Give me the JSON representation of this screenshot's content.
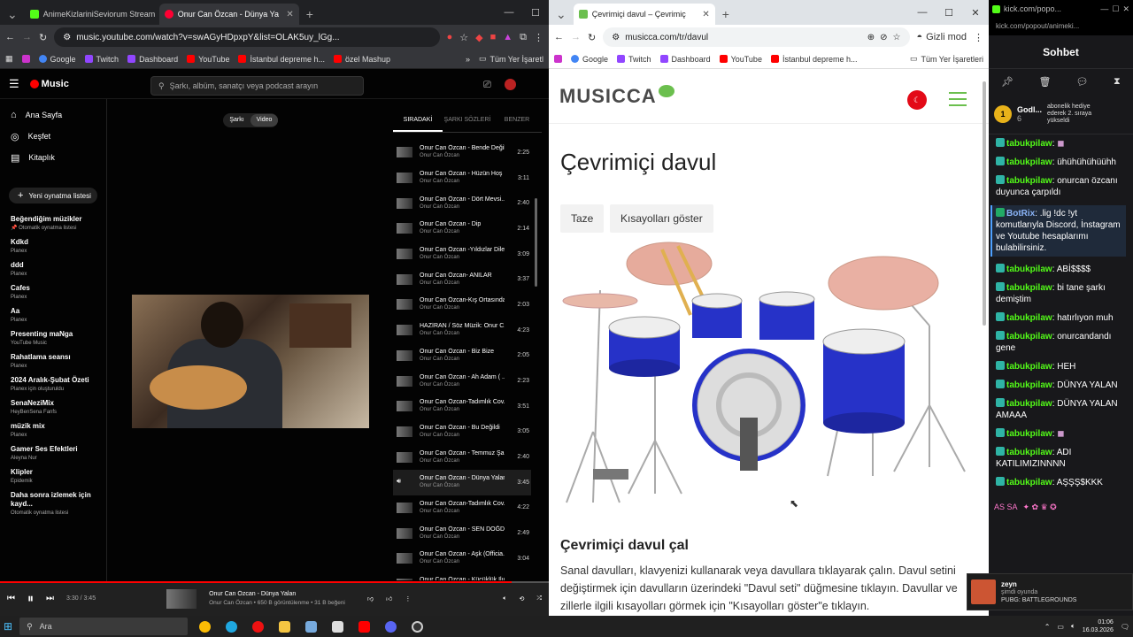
{
  "win1": {
    "tabs": [
      {
        "label": "AnimeKizlariniSeviorum Stream",
        "color": "#53fc18"
      },
      {
        "label": "Onur Can Özcan - Dünya Ya",
        "color": "#f03"
      }
    ],
    "url": "music.youtube.com/watch?v=swAGyHDpxpY&list=OLAK5uy_lGg...",
    "bookmarks": [
      "Google",
      "Twitch",
      "Dashboard",
      "YouTube",
      "İstanbul depreme h...",
      "özel Mashup"
    ],
    "bookmarks_folder": "Tüm Yer İşaretl",
    "app": {
      "logo": "Music",
      "search_placeholder": "Şarkı, albüm, sanatçı veya podcast arayın",
      "nav": [
        {
          "label": "Ana Sayfa",
          "icon": "home-icon",
          "glyph": "⌂"
        },
        {
          "label": "Keşfet",
          "icon": "compass-icon",
          "glyph": "◎"
        },
        {
          "label": "Kitaplık",
          "icon": "library-icon",
          "glyph": "▤"
        }
      ],
      "new_playlist": "Yeni oynatma listesi",
      "playlists": [
        {
          "title": "Beğendiğim müzikler",
          "sub": "📌 Otomatik oynatma listesi"
        },
        {
          "title": "Kdkd",
          "sub": "Planex"
        },
        {
          "title": "ddd",
          "sub": "Planex"
        },
        {
          "title": "Cafes",
          "sub": "Planex"
        },
        {
          "title": "Aa",
          "sub": "Planex"
        },
        {
          "title": "Presenting maNga",
          "sub": "YouTube Music"
        },
        {
          "title": "Rahatlama seansı",
          "sub": "Planex"
        },
        {
          "title": "2024 Aralık-Şubat Özeti",
          "sub": "Planex için oluşturuldu"
        },
        {
          "title": "SenaNeziMix",
          "sub": "HeyBenSena Fanfs"
        },
        {
          "title": "müzik mix",
          "sub": "Planex"
        },
        {
          "title": "Gamer Ses Efektleri",
          "sub": "Aleyna Nur"
        },
        {
          "title": "Klipler",
          "sub": "Epidemik"
        },
        {
          "title": "Daha sonra izlemek için kayd...",
          "sub": "Otomatik oynatma listesi"
        }
      ],
      "toggle": [
        "Şarkı",
        "Video"
      ],
      "queue_tabs": [
        "SIRADAKİ",
        "ŞARKI SÖZLERİ",
        "BENZER"
      ],
      "queue": [
        {
          "title": "Onur Can Özcan - Bende Değil...",
          "artist": "Onur Can Özcan",
          "dur": "2:25"
        },
        {
          "title": "Onur Can Özcan - Hüzün Hoş ...",
          "artist": "Onur Can Özcan",
          "dur": "3:11"
        },
        {
          "title": "Onur Can Özcan - Dört Mevsi...",
          "artist": "Onur Can Özcan",
          "dur": "2:40"
        },
        {
          "title": "Onur Can Özcan - Dip",
          "artist": "Onur Can Özcan",
          "dur": "2:14"
        },
        {
          "title": "Onur Can Özcan -Yıldızlar Dile...",
          "artist": "Onur Can Özcan",
          "dur": "3:09"
        },
        {
          "title": "Onur Can Özcan- ANILAR",
          "artist": "Onur Can Özcan",
          "dur": "3:37"
        },
        {
          "title": "Onur Can Özcan-Kış Ortasında",
          "artist": "Onur Can Özcan",
          "dur": "2:03"
        },
        {
          "title": "HAZİRAN / Söz Müzik: Onur C...",
          "artist": "Onur Can Özcan",
          "dur": "4:23"
        },
        {
          "title": "Onur Can Özcan - Biz Bize",
          "artist": "Onur Can Özcan",
          "dur": "2:05"
        },
        {
          "title": "Onur Can Özcan - Ah Adam ( ...",
          "artist": "Onur Can Özcan",
          "dur": "2:23"
        },
        {
          "title": "Onur Can Özcan-Tadımlık Cov...",
          "artist": "Onur Can Özcan",
          "dur": "3:51"
        },
        {
          "title": "Onur Can Özcan - Bu Değildi",
          "artist": "Onur Can Özcan",
          "dur": "3:05"
        },
        {
          "title": "Onur Can Özcan - Temmuz Şa...",
          "artist": "Onur Can Özcan",
          "dur": "2:40"
        },
        {
          "title": "Onur Can Özcan - Dünya Yalan",
          "artist": "Onur Can Özcan",
          "dur": "3:45"
        },
        {
          "title": "Onur Can Özcan-Tadımlık Cov...",
          "artist": "Onur Can Özcan",
          "dur": "4:22"
        },
        {
          "title": "Onur Can Özcan - SEN DOĞD...",
          "artist": "Onur Can Özcan",
          "dur": "2:49"
        },
        {
          "title": "Onur Can Özcan - Aşk (Officia...",
          "artist": "Onur Can Özcan",
          "dur": "3:04"
        },
        {
          "title": "Onur Can Özcan - Küçüklük Ilu...",
          "artist": "Onur Can Özcan",
          "dur": ""
        }
      ],
      "current_index": 13,
      "player": {
        "time": "3:30 / 3:45",
        "progress": 0.933,
        "title": "Onur Can Özcan - Dünya Yalan",
        "meta": "Onur Can Özcan • 650 B görüntülenme • 31 B beğeni"
      }
    }
  },
  "win2": {
    "tab": "Çevrimiçi davul – Çevrimiç",
    "url": "musicca.com/tr/davul",
    "incognito": "Gizli mod",
    "bookmarks": [
      "Google",
      "Twitch",
      "Dashboard",
      "YouTube",
      "İstanbul depreme h..."
    ],
    "bookmarks_folder": "Tüm Yer İşaretleri",
    "logo": "MUSICCA",
    "heading": "Çevrimiçi davul",
    "btn_fresh": "Taze",
    "btn_shortcuts": "Kısayolları göster",
    "subheading": "Çevrimiçi davul çal",
    "paragraph": "Sanal davulları, klavyenizi kullanarak veya davullara tıklayarak çalın. Davul setini değiştirmek için davulların üzerindeki \"Davul seti\" düğmesine tıklayın. Davullar ve zillerle ilgili kısayolları görmek için \"Kısayolları göster\"e tıklayın."
  },
  "win3": {
    "url": "kick.com/popo...",
    "title": "Sohbet",
    "goal": {
      "name": "Godl...",
      "count": "6",
      "gift": "abonelik hediye ederek 2. sıraya yükseldi"
    },
    "messages": [
      {
        "user": "tabukpilaw",
        "text": ""
      },
      {
        "user": "tabukpilaw",
        "text": "ühühühühüühh"
      },
      {
        "user": "tabukpilaw",
        "text": "onurcan özcanı duyunca çarpıldı"
      },
      {
        "user": "BotRix",
        "text": ".lig !dc !yt komutlarıyla Discord, İnstagram ve Youtube hesaplarımı bulabilirsiniz.",
        "highlight": true
      },
      {
        "user": "tabukpilaw",
        "text": "ABİ$$$$"
      },
      {
        "user": "tabukpilaw",
        "text": "bi tane şarkı demiştim"
      },
      {
        "user": "tabukpilaw",
        "text": "hatırlıyon muh"
      },
      {
        "user": "tabukpilaw",
        "text": "onurcandandı gene"
      },
      {
        "user": "tabukpilaw",
        "text": "HEH"
      },
      {
        "user": "tabukpilaw",
        "text": "DÜNYA YALAN"
      },
      {
        "user": "tabukpilaw",
        "text": "DÜNYA YALAN AMAAA"
      },
      {
        "user": "tabukpilaw",
        "text": ""
      },
      {
        "user": "tabukpilaw",
        "text": "ADI KATILIMIZINNNN"
      },
      {
        "user": "tabukpilaw",
        "text": "AŞŞŞ$KKK"
      }
    ],
    "emotes": "AS SA",
    "notification": {
      "name": "zeyn",
      "status": "şimdi oyunda",
      "game": "PUBG: BATTLEGROUNDS"
    }
  },
  "taskbar": {
    "search": "Ara",
    "time": "01:06",
    "date": "16.03.2026"
  },
  "colors": {
    "yt_red": "#ff0000",
    "kick_green": "#53fc18",
    "musicca_green": "#6bbf4e",
    "drum_blue": "#2632c8"
  }
}
